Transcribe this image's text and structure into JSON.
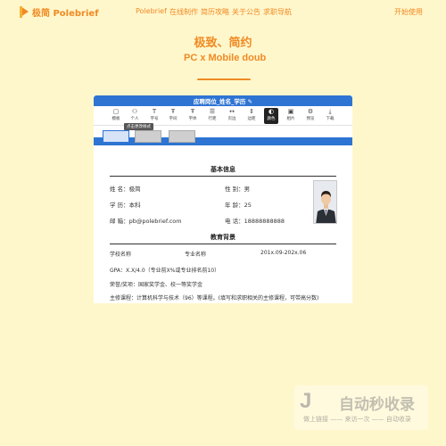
{
  "nav": {
    "logo_text": "极简 Polebrief",
    "links": [
      "Polebrief",
      "在线制作",
      "简历攻略",
      "关于公告",
      "求职导航"
    ],
    "cta": "开始使用"
  },
  "hero": {
    "title": "极致、简约",
    "subtitle": "PC x Mobile double"
  },
  "app": {
    "title": "应聘岗位_姓名_学历 ✎",
    "tools": [
      {
        "label": "模板",
        "icon": "template-icon"
      },
      {
        "label": "个人",
        "icon": "person-icon"
      },
      {
        "label": "字号",
        "icon": "font-size-icon"
      },
      {
        "label": "字间",
        "icon": "letter-spacing-icon"
      },
      {
        "label": "字体",
        "icon": "font-family-icon"
      },
      {
        "label": "行距",
        "icon": "line-height-icon"
      },
      {
        "label": "页边",
        "icon": "margin-icon"
      },
      {
        "label": "边距",
        "icon": "padding-icon"
      },
      {
        "label": "颜色",
        "icon": "color-icon"
      },
      {
        "label": "相片",
        "icon": "photo-icon"
      },
      {
        "label": "预览",
        "icon": "preview-icon"
      },
      {
        "label": "下载",
        "icon": "download-icon"
      }
    ],
    "tooltip": "点击更改样式"
  },
  "resume": {
    "basic_title": "基本信息",
    "name": "姓 名：极简",
    "gender": "性 别：男",
    "education": "学 历：本科",
    "age": "年 龄：25",
    "email": "邮 箱：pb@polebrief.com",
    "phone": "电 话：18888888888",
    "edu_title": "教育背景",
    "school": "学校名称",
    "major": "专业名称",
    "period": "201x.09-202x.06",
    "gpa": "GPA：X.X/4.0（专业前X%或专业排名前10）",
    "honors": "荣誉/奖项：国家奖学金、校一等奖学金",
    "courses": "主修课程：计算机科学与技术（96）等课程。(填写和求职相关的主修课程，可带高分数)"
  },
  "watermark": {
    "mark": "J",
    "text": "自动秒收录",
    "sub": "做上链接 —— 来访一次 —— 自动收录"
  },
  "colors": {
    "accent": "#f08a24",
    "bg": "#fff7cc",
    "app_blue": "#2e74d3"
  }
}
